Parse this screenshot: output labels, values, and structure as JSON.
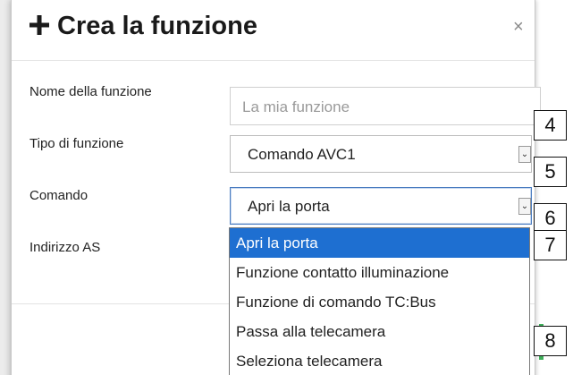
{
  "dialog": {
    "title_icon": "plus-icon",
    "title": "Crea la funzione",
    "close_label": "×"
  },
  "form": {
    "name_label": "Nome della funzione",
    "name_placeholder": "La mia funzione",
    "type_label": "Tipo di funzione",
    "type_value": "Comando AVC1",
    "command_label": "Comando",
    "command_value": "Apri la porta",
    "address_label": "Indirizzo AS"
  },
  "dropdown": {
    "options": [
      "Apri la porta",
      "Funzione contatto illuminazione",
      "Funzione di comando TC:Bus",
      "Passa alla telecamera",
      "Seleziona telecamera"
    ],
    "selected_index": 0
  },
  "callouts": [
    "4",
    "5",
    "6",
    "7",
    "8"
  ],
  "colors": {
    "selection": "#1e6fd1",
    "accent_green": "#3fae5a"
  }
}
